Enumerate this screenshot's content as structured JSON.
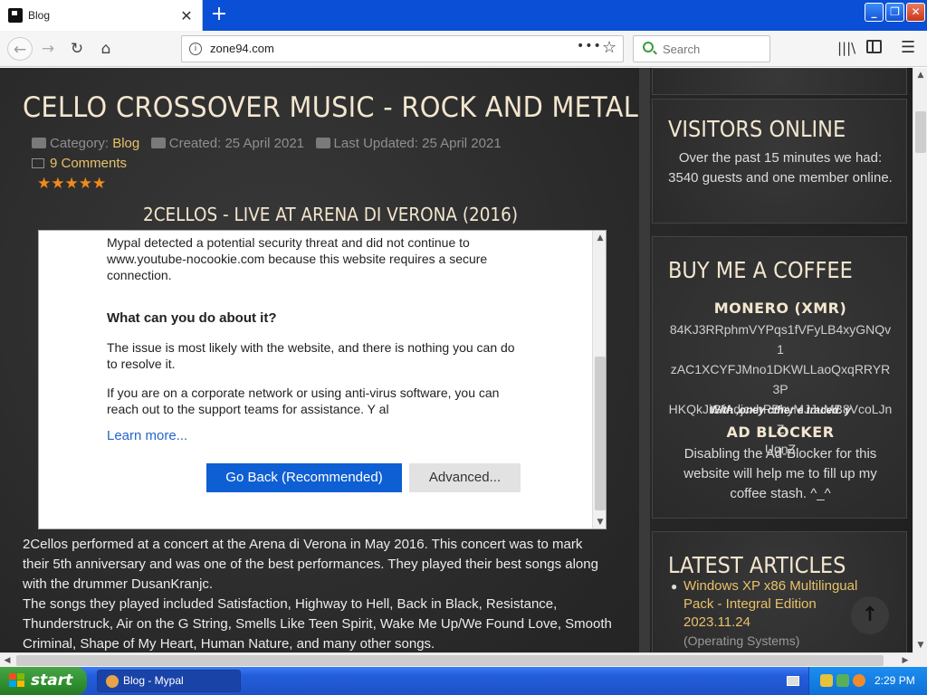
{
  "browser": {
    "tab_title": "Blog",
    "tab_close": "✕",
    "new_tab": "+",
    "url": "zone94.com",
    "search_placeholder": "Search"
  },
  "article": {
    "title": "CELLO CROSSOVER MUSIC - ROCK AND METAL",
    "category_label": "Category: ",
    "category_value": "Blog",
    "created": "Created: 25 April 2021",
    "updated": "Last Updated: 25 April 2021",
    "comments": "9 Comments",
    "rating": "★★★★★",
    "video_title": "2CELLOS - LIVE AT ARENA DI VERONA (2016)",
    "body_lines": [
      "2Cellos performed at a concert at the Arena di Verona in May 2016. This concert was to mark",
      "their 5th anniversary and was one of the best performances. They played their best songs along",
      "with the drummer DusanKranjc.",
      "The songs they played included Satisfaction, Highway to Hell, Back in Black, Resistance,",
      "Thunderstruck, Air on the G String, Smells Like Teen Spirit, Wake Me Up/We Found Love, Smooth",
      "Criminal, Shape of My Heart, Human Nature, and many other songs."
    ]
  },
  "embed_error": {
    "p1": "Mypal detected a potential security threat and did not continue to www.youtube-nocookie.com because this website requires a secure connection.",
    "heading": "What can you do about it?",
    "p2": "The issue is most likely with the website, and there is nothing you can do to resolve it.",
    "p3": "If you are on a corporate network or using anti-virus software, you can reach out to the support teams for assistance. Y          al",
    "learn_more": "Learn more...",
    "go_back": "Go Back (Recommended)",
    "advanced": "Advanced..."
  },
  "sidebar": {
    "visitors_title": "VISITORS ONLINE",
    "visitors_text": "Over the past 15 minutes we had: 3540 guests and one member online.",
    "coffee_title": "BUY ME A COFFEE",
    "monero_title": "MONERO (XMR)",
    "monero_address_lines": [
      "84KJ3RRphmVYPqs1fVFyLB4xyGNQv1",
      "zAC1XCYFJMno1DKWLLaoQxqRRYR3P",
      "HKQkJiGfAdjcxhPBhyMJJuMB8VcoLJnZ",
      "UgnZ"
    ],
    "monero_note": "With ,oney cther e traced. y",
    "adblock_title": "AD BLOCKER",
    "adblock_text": "Disabling the Ad-Blocker for this website will help me to fill up my coffee stash. ^_^",
    "latest_title": "LATEST ARTICLES",
    "latest_item": "Windows XP x86 Multilingual Pack - Integral Edition 2023.11.24",
    "latest_item_sub": "(Operating Systems)",
    "scroll_top": "↑"
  },
  "taskbar": {
    "start": "start",
    "task": "Blog - Mypal",
    "clock": "2:29 PM"
  }
}
